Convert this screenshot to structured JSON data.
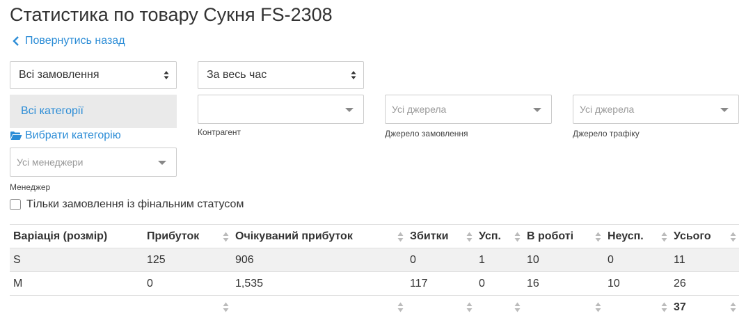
{
  "page": {
    "title": "Статистика по товару Сукня FS-2308",
    "back_label": "Повернутись назад"
  },
  "filters": {
    "orders_select": "Всі замовлення",
    "period_select": "За весь час",
    "category_selected": "Всі категорії",
    "choose_category_label": "Вибрати категорію",
    "counterparty_value": "",
    "counterparty_label": "Контрагент",
    "order_source_placeholder": "Усі джерела",
    "order_source_label": "Джерело замовлення",
    "traffic_source_placeholder": "Усі джерела",
    "traffic_source_label": "Джерело трафіку",
    "manager_placeholder": "Усі менеджери",
    "manager_label": "Менеджер",
    "final_status_label": "Тільки замовлення із фінальним статусом",
    "final_status_checked": false
  },
  "table": {
    "columns": [
      "Варіація (розмір)",
      "Прибуток",
      "Очікуваний прибуток",
      "Збитки",
      "Усп.",
      "В роботі",
      "Неусп.",
      "Усього"
    ],
    "rows": [
      [
        "S",
        "125",
        "906",
        "0",
        "1",
        "10",
        "0",
        "11"
      ],
      [
        "M",
        "0",
        "1,535",
        "117",
        "0",
        "16",
        "10",
        "26"
      ]
    ],
    "footer": [
      "",
      "",
      "",
      "",
      "",
      "",
      "",
      "37"
    ]
  },
  "colors": {
    "link": "#2b8cd6",
    "text": "#333333",
    "border": "#cccccc",
    "row_stripe": "#f1f1f1"
  }
}
